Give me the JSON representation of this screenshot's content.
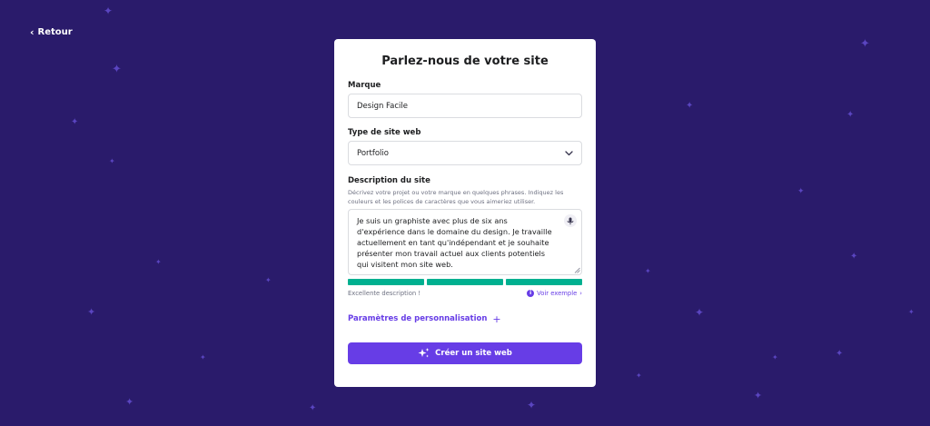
{
  "nav": {
    "back_label": "Retour",
    "back_icon": "chevron-left-icon"
  },
  "card": {
    "title": "Parlez-nous de votre site",
    "brand": {
      "label": "Marque",
      "value": "Design Facile"
    },
    "site_type": {
      "label": "Type de site web",
      "value": "Portfolio",
      "icon": "chevron-down-icon"
    },
    "description": {
      "label": "Description du site",
      "helper": "Décrivez votre projet ou votre marque en quelques phrases. Indiquez les couleurs et les polices de caractères que vous aimeriez utiliser.",
      "value": "Je suis un graphiste avec plus de six ans d'expérience dans le domaine du design. Je travaille actuellement en tant qu'indépendant et je souhaite présenter mon travail actuel aux clients potentiels qui visitent mon site web.",
      "mic_icon": "microphone-icon"
    },
    "quality": {
      "segments_filled": 3,
      "segments_total": 3,
      "color": "#00b090",
      "status": "Excellente description !",
      "example_link": "Voir exemple",
      "example_icon": "info-icon"
    },
    "customization": {
      "label": "Paramètres de personnalisation",
      "icon": "plus-icon"
    },
    "submit": {
      "label": "Créer un site web",
      "icon": "sparkles-icon"
    }
  },
  "colors": {
    "background": "#2a1b6b",
    "accent": "#673de6",
    "success": "#00b090"
  }
}
